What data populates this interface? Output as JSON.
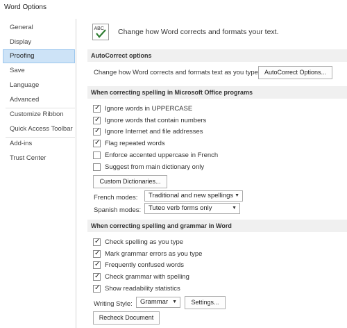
{
  "window": {
    "title": "Word Options"
  },
  "nav": {
    "items": [
      {
        "label": "General",
        "selected": false
      },
      {
        "label": "Display",
        "selected": false
      },
      {
        "label": "Proofing",
        "selected": true
      },
      {
        "label": "Save",
        "selected": false
      },
      {
        "label": "Language",
        "selected": false
      },
      {
        "label": "Advanced",
        "selected": false
      },
      {
        "label": "Customize Ribbon",
        "selected": false
      },
      {
        "label": "Quick Access Toolbar",
        "selected": false
      },
      {
        "label": "Add-ins",
        "selected": false
      },
      {
        "label": "Trust Center",
        "selected": false
      }
    ]
  },
  "header": {
    "icon": "abc-check-icon",
    "icon_text": "ABC",
    "text": "Change how Word corrects and formats your text."
  },
  "autocorrect": {
    "section_title": "AutoCorrect options",
    "description": "Change how Word corrects and formats text as you type:",
    "button_label": "AutoCorrect Options..."
  },
  "spelling_office": {
    "section_title": "When correcting spelling in Microsoft Office programs",
    "options": [
      {
        "label": "Ignore words in UPPERCASE",
        "checked": true
      },
      {
        "label": "Ignore words that contain numbers",
        "checked": true
      },
      {
        "label": "Ignore Internet and file addresses",
        "checked": true
      },
      {
        "label": "Flag repeated words",
        "checked": true
      },
      {
        "label": "Enforce accented uppercase in French",
        "checked": false
      },
      {
        "label": "Suggest from main dictionary only",
        "checked": false
      }
    ],
    "custom_dictionaries_label": "Custom Dictionaries...",
    "french_modes_label": "French modes:",
    "french_modes_value": "Traditional and new spellings",
    "spanish_modes_label": "Spanish modes:",
    "spanish_modes_value": "Tuteo verb forms only"
  },
  "spelling_word": {
    "section_title": "When correcting spelling and grammar in Word",
    "options": [
      {
        "label": "Check spelling as you type",
        "checked": true
      },
      {
        "label": "Mark grammar errors as you type",
        "checked": true
      },
      {
        "label": "Frequently confused words",
        "checked": true
      },
      {
        "label": "Check grammar with spelling",
        "checked": true
      },
      {
        "label": "Show readability statistics",
        "checked": true
      }
    ],
    "writing_style_label": "Writing Style:",
    "writing_style_value": "Grammar",
    "settings_label": "Settings...",
    "recheck_label": "Recheck Document"
  },
  "colors": {
    "selected_bg": "#cde3f7",
    "selected_border": "#9cc7ee",
    "section_bg": "#f0f0f0",
    "icon_check": "#2e7d32"
  }
}
